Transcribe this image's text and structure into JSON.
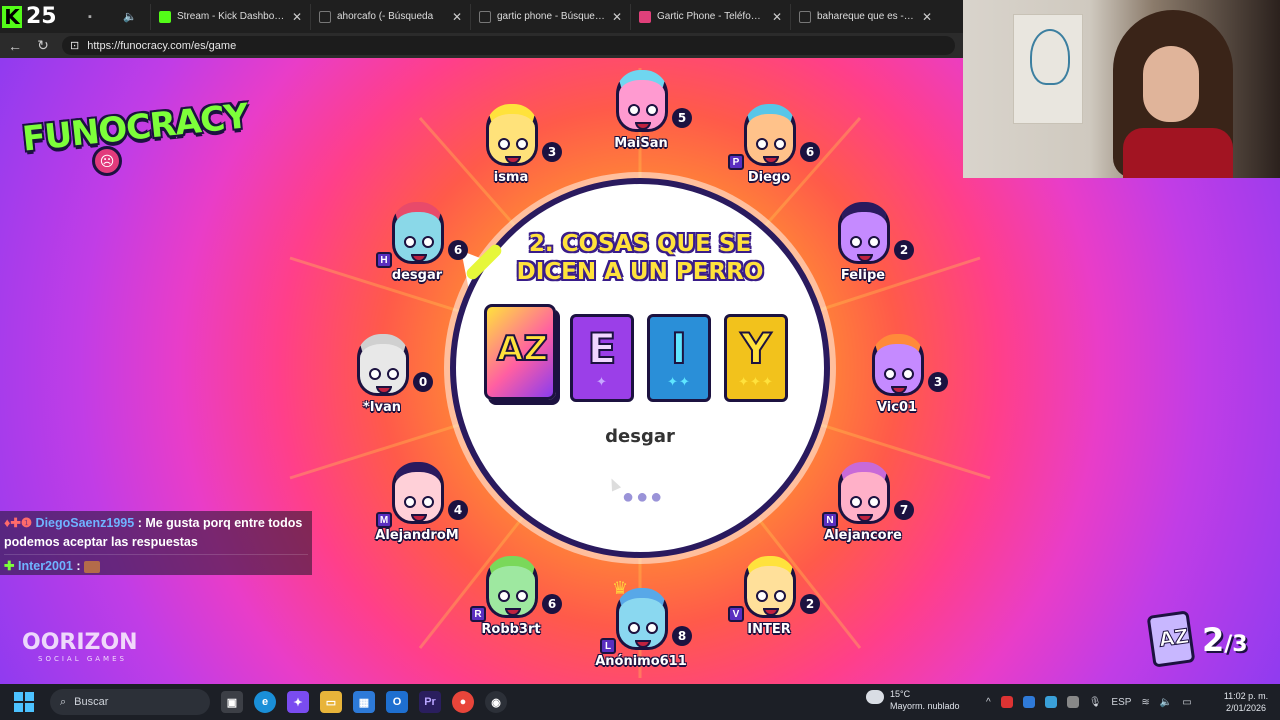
{
  "browser": {
    "kick_count": "25",
    "tabs": [
      {
        "label": "Stream - Kick Dashboard",
        "color": "#53fc18"
      },
      {
        "label": "ahorcafo (- Búsqueda",
        "color": "#3b6fd8"
      },
      {
        "label": "gartic phone - Búsqueda",
        "color": "#3b6fd8"
      },
      {
        "label": "Gartic Phone - Teléfono Descor",
        "color": "#e0407a"
      },
      {
        "label": "bahareque que es - Búsqueda",
        "color": "#3b6fd8"
      }
    ],
    "url": "https://funocracy.com/es/game"
  },
  "game": {
    "logo": "FUNOCRACY",
    "question": "2. COSAS QUE SE DICEN A UN PERRO",
    "cards": [
      {
        "letter": "E",
        "stars": "✦",
        "bg": "#9b3fe8",
        "fg": "#f1d7ff",
        "star_color": "#c6a8ff"
      },
      {
        "letter": "I",
        "stars": "✦✦",
        "bg": "#2a8fd8",
        "fg": "#5fe6ff",
        "star_color": "#5fe6ff"
      },
      {
        "letter": "Y",
        "stars": "✦✦✦",
        "bg": "#f2c21c",
        "fg": "#ffe23c",
        "star_color": "#ffe23c"
      }
    ],
    "az_card": "AZ",
    "current_drawer": "desgar",
    "loading_dots": "●●●",
    "players": [
      {
        "name": "MaiSan",
        "score": "5",
        "color": "#ff9ad0",
        "hair": "#6fd6f0",
        "tag": ""
      },
      {
        "name": "isma",
        "score": "3",
        "color": "#ffe27a",
        "hair": "#ffe23c",
        "tag": ""
      },
      {
        "name": "Diego",
        "score": "6",
        "color": "#ffc28a",
        "hair": "#58c6e8",
        "tag": "P"
      },
      {
        "name": "desgar",
        "score": "6",
        "color": "#8ad8e8",
        "hair": "#e84a6a",
        "tag": "H"
      },
      {
        "name": "Felipe",
        "score": "2",
        "color": "#c58aff",
        "hair": "#2a1a5e",
        "tag": ""
      },
      {
        "name": "*Ivan",
        "score": "0",
        "color": "#e8e8e8",
        "hair": "#d0d0d0",
        "tag": ""
      },
      {
        "name": "Vic01",
        "score": "3",
        "color": "#c58aff",
        "hair": "#ff8a3a",
        "tag": ""
      },
      {
        "name": "AlejandroM",
        "score": "4",
        "color": "#ffd0d8",
        "hair": "#2a1a5e",
        "tag": "M"
      },
      {
        "name": "Alejancore",
        "score": "7",
        "color": "#ffb0c8",
        "hair": "#c86ad8",
        "tag": "N"
      },
      {
        "name": "Robb3rt",
        "score": "6",
        "color": "#9ee8a0",
        "hair": "#7ad85a",
        "tag": "R"
      },
      {
        "name": "Anónimo611",
        "score": "8",
        "color": "#8ad8f0",
        "hair": "#58a8e8",
        "tag": "L"
      },
      {
        "name": "INTER",
        "score": "2",
        "color": "#ffe09a",
        "hair": "#ffe23c",
        "tag": "V"
      }
    ],
    "round_current": "2",
    "round_total": "/3",
    "brand": "OORIZON",
    "brand_sub": "SOCIAL GAMES"
  },
  "chat": {
    "messages": [
      {
        "user": "DiegoSaenz1995",
        "text": ": Me gusta porq entre todos podemos aceptar las respuestas"
      },
      {
        "user": "Inter2001",
        "text": ":"
      }
    ]
  },
  "taskbar": {
    "search_label": "Buscar",
    "weather_temp": "15°C",
    "weather_desc": "Mayorm. nublado",
    "lang": "ESP",
    "time": "11:02 p. m.",
    "date": "2/01/2026"
  }
}
